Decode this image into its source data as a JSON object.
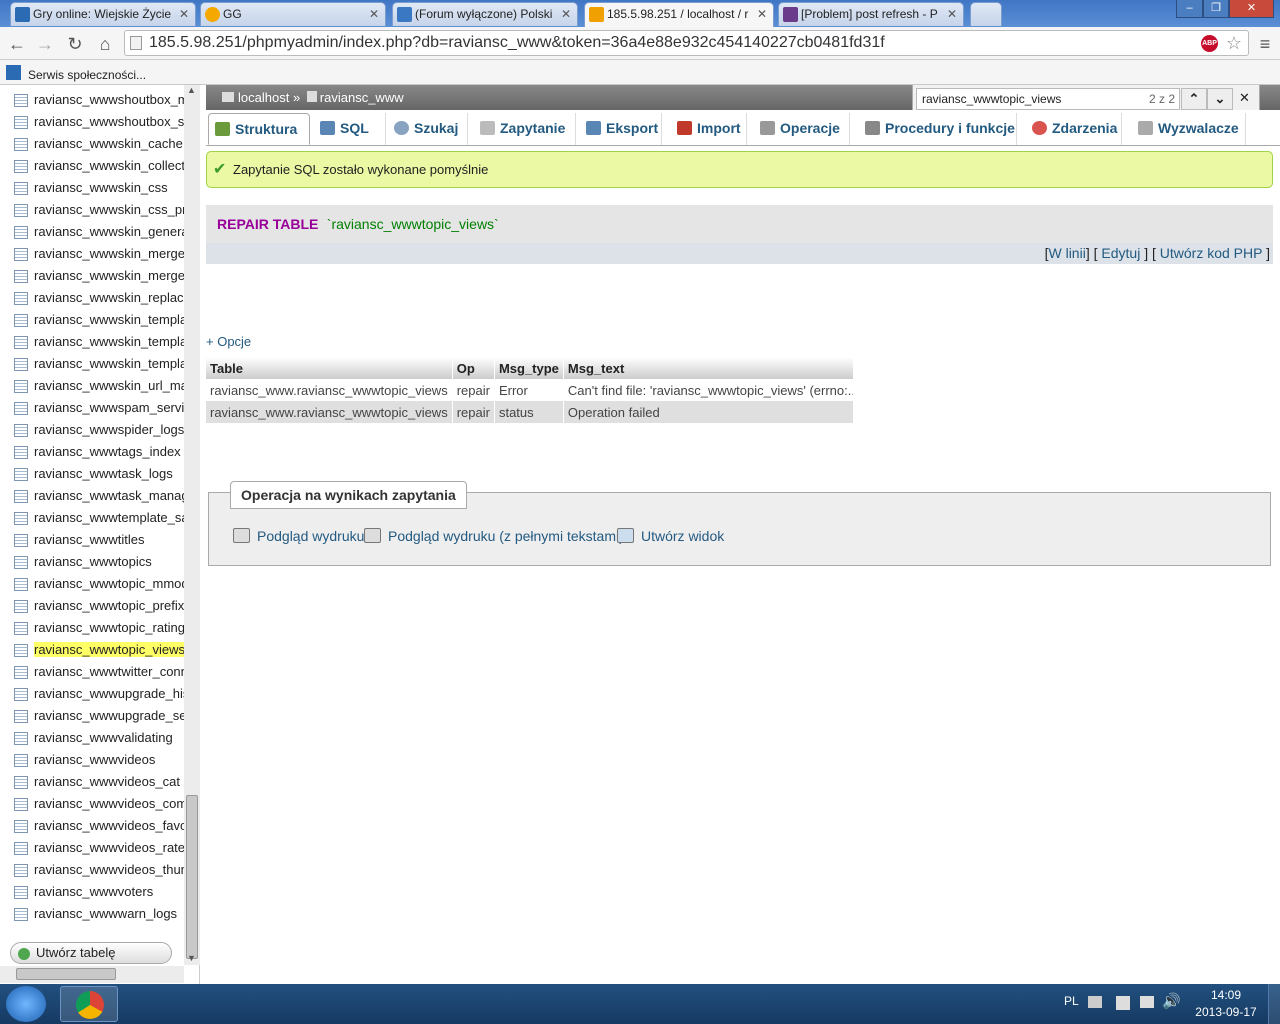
{
  "browser": {
    "tabs": [
      {
        "title": "Gry online: Wiejskie Życie",
        "icon": "nk-icon",
        "icon_color": "#2b6bb4"
      },
      {
        "title": "GG",
        "icon": "gg-sun-icon",
        "icon_color": "#f5a800"
      },
      {
        "title": "(Forum wyłączone) Polski",
        "icon": "forum-icon",
        "icon_color": "#3b78c4"
      },
      {
        "title": "185.5.98.251 / localhost / r",
        "icon": "pma-icon",
        "icon_color": "#f0a000",
        "active": true
      },
      {
        "title": "[Problem] post refresh - P",
        "icon": "mybb-icon",
        "icon_color": "#6a3b8a"
      }
    ],
    "url": "185.5.98.251/phpmyadmin/index.php?db=raviansc_www&token=36a4e88e932c454140227cb0481fd31f",
    "bookmark": "Serwis społeczności...",
    "abp_label": "ABP"
  },
  "sidebar": {
    "items": [
      "raviansc_wwwshoutbox_m",
      "raviansc_wwwshoutbox_s",
      "raviansc_wwwskin_cache",
      "raviansc_wwwskin_collect",
      "raviansc_wwwskin_css",
      "raviansc_wwwskin_css_pr",
      "raviansc_wwwskin_genera",
      "raviansc_wwwskin_merge",
      "raviansc_wwwskin_merge",
      "raviansc_wwwskin_replace",
      "raviansc_wwwskin_templa",
      "raviansc_wwwskin_templa",
      "raviansc_wwwskin_templa",
      "raviansc_wwwskin_url_ma",
      "raviansc_wwwspam_servi",
      "raviansc_wwwspider_logs",
      "raviansc_wwwtags_index",
      "raviansc_wwwtask_logs",
      "raviansc_wwwtask_manag",
      "raviansc_wwwtemplate_sa",
      "raviansc_wwwtitles",
      "raviansc_wwwtopics",
      "raviansc_wwwtopic_mmod",
      "raviansc_wwwtopic_prefix",
      "raviansc_wwwtopic_rating",
      "raviansc_wwwtopic_views",
      "raviansc_wwwtwitter_conn",
      "raviansc_wwwupgrade_his",
      "raviansc_wwwupgrade_se",
      "raviansc_wwwvalidating",
      "raviansc_wwwvideos",
      "raviansc_wwwvideos_cat",
      "raviansc_wwwvideos_com",
      "raviansc_wwwvideos_favor",
      "raviansc_wwwvideos_rate",
      "raviansc_wwwvideos_thum",
      "raviansc_wwwvoters",
      "raviansc_wwwwarn_logs"
    ],
    "highlighted": "raviansc_wwwtopic_views",
    "create_table": "Utwórz tabelę"
  },
  "breadcrumb": {
    "server": "localhost",
    "sep": "»",
    "db": "raviansc_www"
  },
  "find": {
    "query": "raviansc_wwwtopic_views",
    "count": "2 z 2"
  },
  "tabs": [
    {
      "label": "Struktura",
      "icon": "structure-icon"
    },
    {
      "label": "SQL",
      "icon": "sql-icon"
    },
    {
      "label": "Szukaj",
      "icon": "search-icon"
    },
    {
      "label": "Zapytanie",
      "icon": "query-icon"
    },
    {
      "label": "Eksport",
      "icon": "export-icon"
    },
    {
      "label": "Import",
      "icon": "import-icon"
    },
    {
      "label": "Operacje",
      "icon": "wrench-icon"
    },
    {
      "label": "Procedury i funkcje",
      "icon": "routines-icon"
    },
    {
      "label": "Zdarzenia",
      "icon": "events-icon"
    },
    {
      "label": "Wyzwalacze",
      "icon": "triggers-icon"
    }
  ],
  "message": "Zapytanie SQL zostało wykonane pomyślnie",
  "sql": {
    "keyword": "REPAIR TABLE",
    "table": "`raviansc_wwwtopic_views`"
  },
  "sql_links": {
    "inline": "W linii",
    "edit": "Edytuj",
    "php": "Utwórz kod PHP"
  },
  "options_label": "+ Opcje",
  "result": {
    "columns": [
      "Table",
      "Op",
      "Msg_type",
      "Msg_text"
    ],
    "rows": [
      [
        "raviansc_www.raviansc_wwwtopic_views",
        "repair",
        "Error",
        "Can't find file: 'raviansc_wwwtopic_views' (errno:..."
      ],
      [
        "raviansc_www.raviansc_wwwtopic_views",
        "repair",
        "status",
        "Operation failed"
      ]
    ]
  },
  "ops": {
    "legend": "Operacja na wynikach zapytania",
    "print": "Podgląd wydruku",
    "print_full": "Podgląd wydruku (z pełnymi tekstami)",
    "create_view": "Utwórz widok"
  },
  "taskbar": {
    "lang": "PL",
    "time": "14:09",
    "date": "2013-09-17"
  },
  "colors": {
    "accent": "#235a81",
    "sql_keyword": "#990099",
    "sql_string": "#008000",
    "success_bg": "#ebf8a4",
    "highlight": "#ffff66"
  }
}
